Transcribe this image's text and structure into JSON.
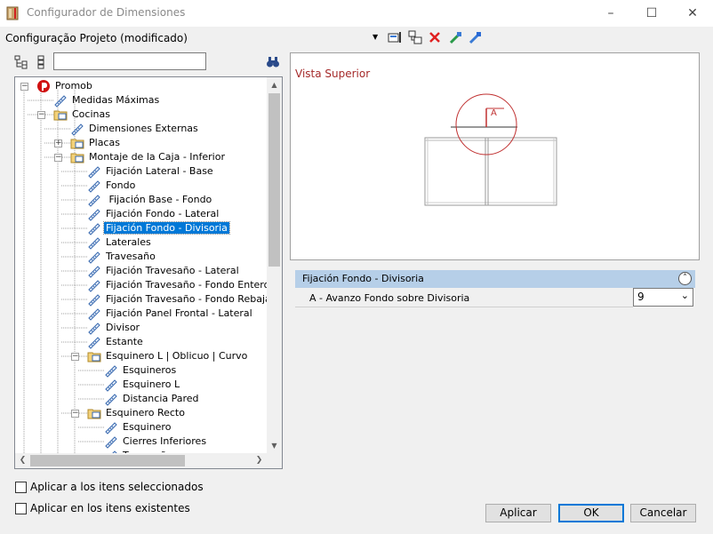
{
  "window": {
    "title": "Configurador de Dimensiones"
  },
  "config": {
    "label": "Configuração Projeto (modificado)"
  },
  "search": {
    "value": ""
  },
  "tree": {
    "items": [
      {
        "label": "Promob",
        "level": 0,
        "icon": "promob-logo-icon",
        "expander": "−"
      },
      {
        "label": "Medidas Máximas",
        "level": 1,
        "icon": "ruler-icon"
      },
      {
        "label": "Cocinas",
        "level": 1,
        "icon": "folder-icon",
        "expander": "−"
      },
      {
        "label": "Dimensiones Externas",
        "level": 2,
        "icon": "ruler-icon"
      },
      {
        "label": "Placas",
        "level": 2,
        "icon": "folder-icon",
        "expander": "+"
      },
      {
        "label": "Montaje de la Caja - Inferior",
        "level": 2,
        "icon": "folder-icon",
        "expander": "−"
      },
      {
        "label": "Fijación Lateral - Base",
        "level": 3,
        "icon": "ruler-icon"
      },
      {
        "label": "Fondo",
        "level": 3,
        "icon": "ruler-icon"
      },
      {
        "label": " Fijación Base - Fondo",
        "level": 3,
        "icon": "ruler-icon"
      },
      {
        "label": "Fijación Fondo - Lateral",
        "level": 3,
        "icon": "ruler-icon"
      },
      {
        "label": "Fijación Fondo - Divisoria",
        "level": 3,
        "icon": "ruler-icon",
        "selected": true
      },
      {
        "label": "Laterales",
        "level": 3,
        "icon": "ruler-icon"
      },
      {
        "label": "Travesaño",
        "level": 3,
        "icon": "ruler-icon"
      },
      {
        "label": "Fijación Travesaño - Lateral",
        "level": 3,
        "icon": "ruler-icon"
      },
      {
        "label": "Fijación Travesaño - Fondo Entero",
        "level": 3,
        "icon": "ruler-icon"
      },
      {
        "label": "Fijación Travesaño - Fondo Rebajado",
        "level": 3,
        "icon": "ruler-icon"
      },
      {
        "label": "Fijación Panel Frontal - Lateral",
        "level": 3,
        "icon": "ruler-icon"
      },
      {
        "label": "Divisor",
        "level": 3,
        "icon": "ruler-icon"
      },
      {
        "label": "Estante",
        "level": 3,
        "icon": "ruler-icon"
      },
      {
        "label": "Esquinero L | Oblicuo | Curvo",
        "level": 3,
        "icon": "folder-icon",
        "expander": "−"
      },
      {
        "label": "Esquineros",
        "level": 4,
        "icon": "ruler-icon"
      },
      {
        "label": "Esquinero L",
        "level": 4,
        "icon": "ruler-icon"
      },
      {
        "label": "Distancia Pared",
        "level": 4,
        "icon": "ruler-icon"
      },
      {
        "label": "Esquinero Recto",
        "level": 3,
        "icon": "folder-icon",
        "expander": "−"
      },
      {
        "label": "Esquinero",
        "level": 4,
        "icon": "ruler-icon"
      },
      {
        "label": "Cierres Inferiores",
        "level": 4,
        "icon": "ruler-icon"
      },
      {
        "label": "Travesaño",
        "level": 4,
        "icon": "ruler-icon"
      }
    ]
  },
  "preview": {
    "title": "Vista Superior",
    "marker_label": "A"
  },
  "properties": {
    "header": "Fijación Fondo - Divisoria",
    "rows": [
      {
        "label": "A - Avanzo Fondo sobre Divisoria",
        "value": "9"
      }
    ]
  },
  "options": {
    "apply_selected": "Aplicar a los itens seleccionados",
    "apply_existing": "Aplicar en los itens existentes"
  },
  "buttons": {
    "apply": "Aplicar",
    "ok": "OK",
    "cancel": "Cancelar"
  },
  "colors": {
    "accent": "#0078d7",
    "preview_title": "#a52a2a",
    "prop_header": "#b6cfe8"
  }
}
